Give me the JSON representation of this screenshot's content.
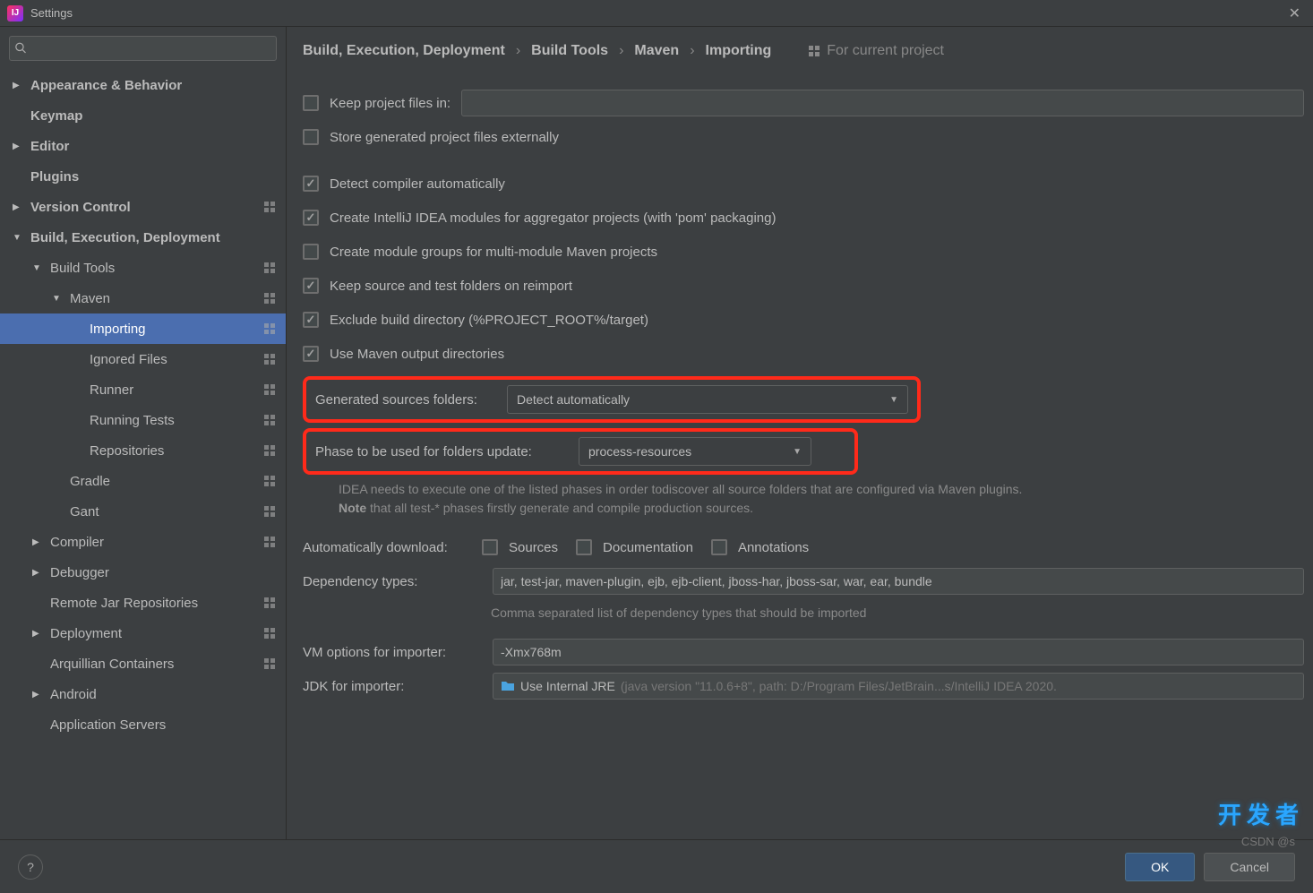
{
  "titlebar": {
    "title": "Settings"
  },
  "sidebar": {
    "items": [
      {
        "label": "Appearance & Behavior",
        "level": 0,
        "arrow": "right",
        "bold": true,
        "proj": false
      },
      {
        "label": "Keymap",
        "level": 0,
        "arrow": "",
        "bold": true,
        "proj": false
      },
      {
        "label": "Editor",
        "level": 0,
        "arrow": "right",
        "bold": true,
        "proj": false
      },
      {
        "label": "Plugins",
        "level": 0,
        "arrow": "",
        "bold": true,
        "proj": false
      },
      {
        "label": "Version Control",
        "level": 0,
        "arrow": "right",
        "bold": true,
        "proj": true
      },
      {
        "label": "Build, Execution, Deployment",
        "level": 0,
        "arrow": "down",
        "bold": true,
        "proj": false
      },
      {
        "label": "Build Tools",
        "level": 1,
        "arrow": "down",
        "bold": false,
        "proj": true
      },
      {
        "label": "Maven",
        "level": 2,
        "arrow": "down",
        "bold": false,
        "proj": true
      },
      {
        "label": "Importing",
        "level": 3,
        "arrow": "",
        "bold": false,
        "proj": true,
        "selected": true
      },
      {
        "label": "Ignored Files",
        "level": 3,
        "arrow": "",
        "bold": false,
        "proj": true
      },
      {
        "label": "Runner",
        "level": 3,
        "arrow": "",
        "bold": false,
        "proj": true
      },
      {
        "label": "Running Tests",
        "level": 3,
        "arrow": "",
        "bold": false,
        "proj": true
      },
      {
        "label": "Repositories",
        "level": 3,
        "arrow": "",
        "bold": false,
        "proj": true
      },
      {
        "label": "Gradle",
        "level": 2,
        "arrow": "",
        "bold": false,
        "proj": true
      },
      {
        "label": "Gant",
        "level": 2,
        "arrow": "",
        "bold": false,
        "proj": true
      },
      {
        "label": "Compiler",
        "level": 1,
        "arrow": "right",
        "bold": false,
        "proj": true
      },
      {
        "label": "Debugger",
        "level": 1,
        "arrow": "right",
        "bold": false,
        "proj": false
      },
      {
        "label": "Remote Jar Repositories",
        "level": 1,
        "arrow": "",
        "bold": false,
        "proj": true
      },
      {
        "label": "Deployment",
        "level": 1,
        "arrow": "right",
        "bold": false,
        "proj": true
      },
      {
        "label": "Arquillian Containers",
        "level": 1,
        "arrow": "",
        "bold": false,
        "proj": true
      },
      {
        "label": "Android",
        "level": 1,
        "arrow": "right",
        "bold": false,
        "proj": false
      },
      {
        "label": "Application Servers",
        "level": 1,
        "arrow": "",
        "bold": false,
        "proj": false
      }
    ]
  },
  "breadcrumb": {
    "parts": [
      "Build, Execution, Deployment",
      "Build Tools",
      "Maven",
      "Importing"
    ],
    "for_project": "For current project"
  },
  "form": {
    "keep_project_files": {
      "label": "Keep project files in:",
      "checked": false,
      "value": ""
    },
    "store_externally": {
      "label": "Store generated project files externally",
      "checked": false
    },
    "detect_compiler": {
      "label": "Detect compiler automatically",
      "checked": true
    },
    "create_modules": {
      "label": "Create IntelliJ IDEA modules for aggregator projects (with 'pom' packaging)",
      "checked": true
    },
    "create_groups": {
      "label": "Create module groups for multi-module Maven projects",
      "checked": false
    },
    "keep_source": {
      "label": "Keep source and test folders on reimport",
      "checked": true
    },
    "exclude_build": {
      "label": "Exclude build directory (%PROJECT_ROOT%/target)",
      "checked": true
    },
    "use_output": {
      "label": "Use Maven output directories",
      "checked": true
    },
    "gen_sources": {
      "label": "Generated sources folders:",
      "value": "Detect automatically"
    },
    "phase": {
      "label": "Phase to be used for folders update:",
      "value": "process-resources"
    },
    "hint_line1": "IDEA needs to execute one of the listed phases in order todiscover all source folders that are configured via Maven plugins.",
    "hint_note": "Note",
    "hint_line2": " that all test-* phases firstly generate and compile production sources.",
    "auto_download": {
      "label": "Automatically download:",
      "sources": "Sources",
      "docs": "Documentation",
      "anno": "Annotations"
    },
    "dep_types": {
      "label": "Dependency types:",
      "value": "jar, test-jar, maven-plugin, ejb, ejb-client, jboss-har, jboss-sar, war, ear, bundle"
    },
    "dep_hint": "Comma separated list of dependency types that should be imported",
    "vm_options": {
      "label": "VM options for importer:",
      "value": "-Xmx768m"
    },
    "jdk": {
      "label": "JDK for importer:",
      "value": "Use Internal JRE",
      "detail": "(java version \"11.0.6+8\", path: D:/Program Files/JetBrain...s/IntelliJ IDEA 2020."
    }
  },
  "buttons": {
    "ok": "OK",
    "cancel": "Cancel"
  },
  "watermark": {
    "logo": "开发者",
    "text": "CSDN @s"
  }
}
